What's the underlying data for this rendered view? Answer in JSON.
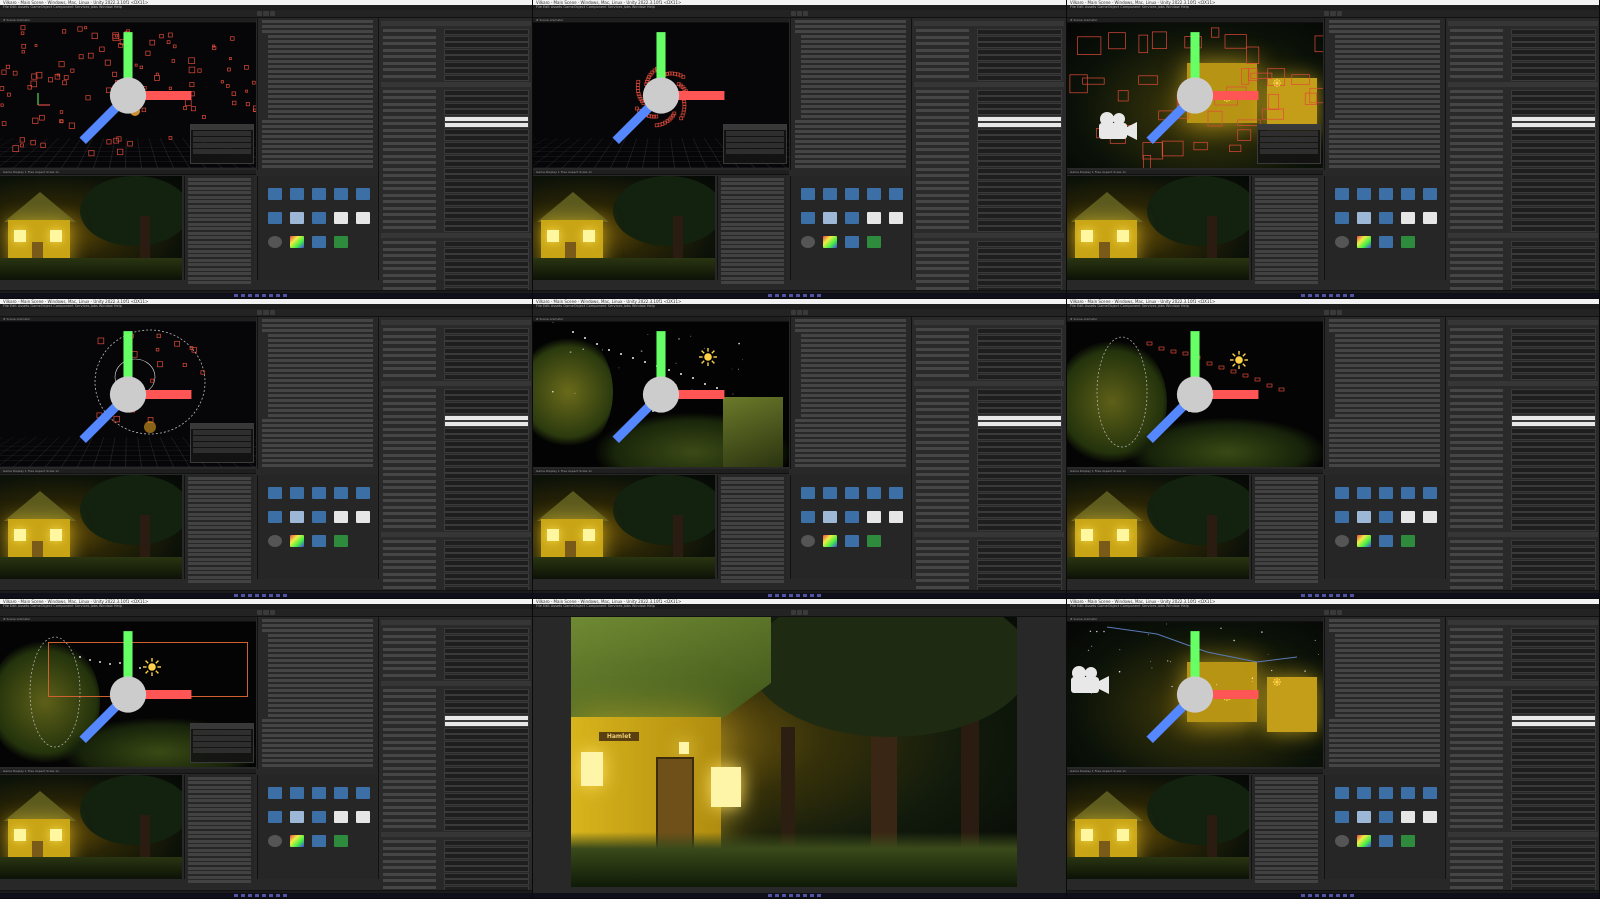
{
  "window": {
    "title": "Vilkaro - Main Scene - Windows, Mac, Linux - Unity 2022.3.10f1 <DX11>",
    "menu": "File  Edit  Assets  GameObject  Component  Services  Jobs  Window  Help"
  },
  "tabs": {
    "scene": "# Scene   Animator",
    "game": "Game   Display 1   Free Aspect   Scale 1x",
    "hierarchy": "Hierarchy",
    "inspector": "Inspector",
    "project": "Project   Console"
  },
  "tiles": [
    {
      "id": "r1c1",
      "scene": "particles"
    },
    {
      "id": "r1c2",
      "scene": "ring"
    },
    {
      "id": "r1c3",
      "scene": "lanterns"
    },
    {
      "id": "r2c1",
      "scene": "circle"
    },
    {
      "id": "r2c2",
      "scene": "sky"
    },
    {
      "id": "r2c3",
      "scene": "trail"
    },
    {
      "id": "r3c1",
      "scene": "trail2"
    },
    {
      "id": "r3c2",
      "scene": "game-only"
    },
    {
      "id": "r3c3",
      "scene": "lanterns2"
    }
  ],
  "house_sign": "Hamlet",
  "colors": {
    "titlebar": "#f2f2f2",
    "panel": "#282828",
    "selection": "#2c5d87",
    "particle_outline": "#e04a3a",
    "light_glow": "#ffe050"
  },
  "icons": [
    "sun-icon",
    "camera-icon",
    "gizmo-icon",
    "folder-icon",
    "material-icon"
  ]
}
